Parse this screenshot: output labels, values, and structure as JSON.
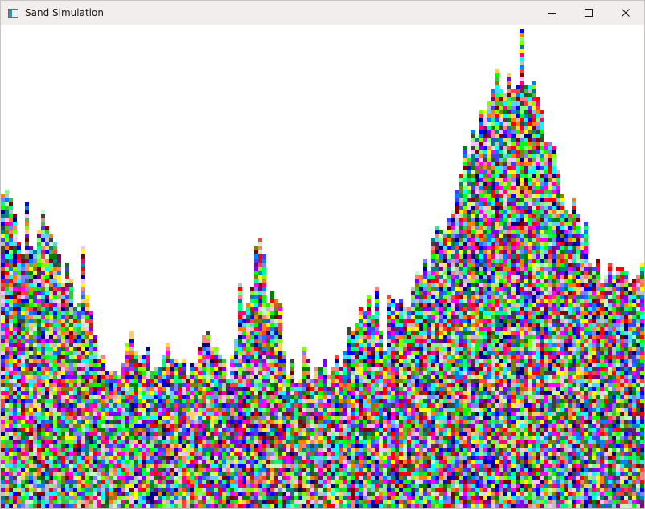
{
  "window": {
    "title": "Sand Simulation",
    "icon": "app-window-icon",
    "controls": {
      "minimize": "minimize-icon",
      "maximize": "maximize-icon",
      "close": "close-icon"
    }
  },
  "simulation": {
    "background": "#ffffff",
    "palette": [
      "#ff0000",
      "#00ff00",
      "#0000ff",
      "#ffff00",
      "#ff00ff",
      "#00ffff",
      "#ff8000",
      "#8000ff",
      "#00ff80",
      "#ff0080",
      "#80ff00",
      "#0080ff",
      "#800000",
      "#008000",
      "#000080",
      "#808000",
      "#800080",
      "#008080",
      "#c0c0c0",
      "#ff8080",
      "#80ff80",
      "#8080ff",
      "#ffc0ff",
      "#c0ffc0",
      "#404040",
      "#ff4040",
      "#40c040",
      "#4040ff",
      "#ffd060",
      "#60d0ff"
    ],
    "column_heights_fraction": [
      0.62,
      0.67,
      0.6,
      0.55,
      0.52,
      0.56,
      0.6,
      0.59,
      0.58,
      0.5,
      0.49,
      0.45,
      0.43,
      0.43,
      0.4,
      0.34,
      0.31,
      0.27,
      0.29,
      0.32,
      0.35,
      0.33,
      0.31,
      0.3,
      0.31,
      0.32,
      0.33,
      0.32,
      0.3,
      0.31,
      0.32,
      0.33,
      0.34,
      0.3,
      0.29,
      0.28,
      0.33,
      0.42,
      0.44,
      0.52,
      0.55,
      0.45,
      0.41,
      0.4,
      0.29,
      0.3,
      0.27,
      0.34,
      0.28,
      0.3,
      0.29,
      0.28,
      0.32,
      0.31,
      0.37,
      0.39,
      0.41,
      0.43,
      0.35,
      0.33,
      0.45,
      0.4,
      0.42,
      0.43,
      0.48,
      0.5,
      0.52,
      0.55,
      0.55,
      0.58,
      0.62,
      0.7,
      0.75,
      0.77,
      0.8,
      0.84,
      0.86,
      0.88,
      0.89,
      0.88,
      0.9,
      0.88,
      0.86,
      0.84,
      0.78,
      0.74,
      0.7,
      0.64,
      0.63,
      0.61,
      0.58,
      0.53,
      0.5,
      0.49,
      0.5,
      0.49,
      0.48,
      0.49,
      0.5,
      0.51
    ]
  }
}
